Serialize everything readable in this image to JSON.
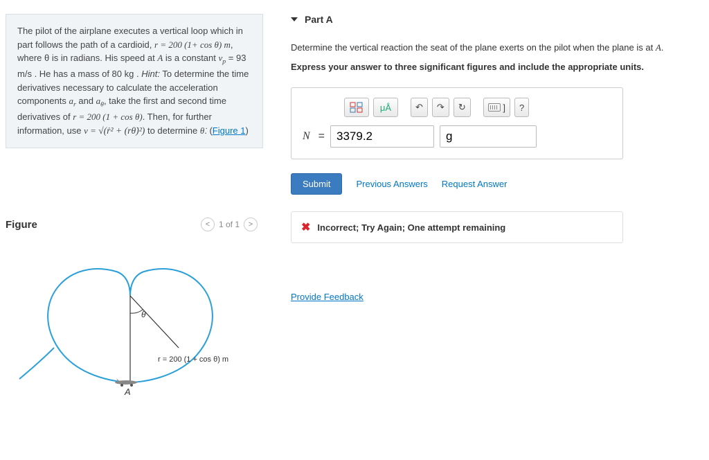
{
  "problem": {
    "text_before_cardioid": "The pilot of the airplane executes a vertical loop which in part follows the path of a cardioid, ",
    "cardioid_eq": "r = 200 (1+ cos θ) m",
    "text_after_cardioid": ", where θ is in radians. His speed at ",
    "point_A": "A",
    "text_after_A": " is a constant ",
    "vp_eq": "v",
    "vp_sub": "p",
    "vp_val": " = 93  m/s",
    "text_mass": " . He has a mass of 80  kg .",
    "hint_label": " Hint:",
    "hint_body": " To determine the time derivatives necessary to calculate the acceleration components ",
    "ar": "a",
    "ar_sub": "r",
    "and1": " and ",
    "ath": "a",
    "ath_sub": "θ",
    "hint_body2": ", take the first and second time derivatives of ",
    "r_eq": "r = 200 (1 + cos θ)",
    "hint_body3": ". Then, for further information, use ",
    "v_eq_lead": "v = ",
    "v_eq_sqrt": "√(ṙ² + (rθ̇)²)",
    "hint_body4": " to determine ",
    "theta_dot": "θ̇",
    "hint_body5": ". (",
    "figure_link": "Figure 1",
    "hint_body6": ")"
  },
  "figure": {
    "title": "Figure",
    "count_label": "1 of 1",
    "equation": "r = 200 (1 + cos θ) m",
    "theta_label": "θ",
    "A_label": "A"
  },
  "partA": {
    "header": "Part A",
    "question_before": "Determine the vertical reaction the seat of the plane exerts on the pilot when the plane is at ",
    "question_A": "A",
    "question_after": ".",
    "instruction": "Express your answer to three significant figures and include the appropriate units.",
    "toolbar": {
      "templates": "⎕̶⎕",
      "units": "μÅ",
      "undo": "↶",
      "redo": "↷",
      "reset": "↻",
      "keyboard": "⌨",
      "help": "?"
    },
    "answer": {
      "label": "N",
      "eq": "=",
      "value": "3379.2",
      "unit": "g"
    },
    "submit_label": "Submit",
    "previous_label": "Previous Answers",
    "request_label": "Request Answer",
    "feedback": "Incorrect; Try Again; One attempt remaining"
  },
  "provide_feedback": "Provide Feedback"
}
